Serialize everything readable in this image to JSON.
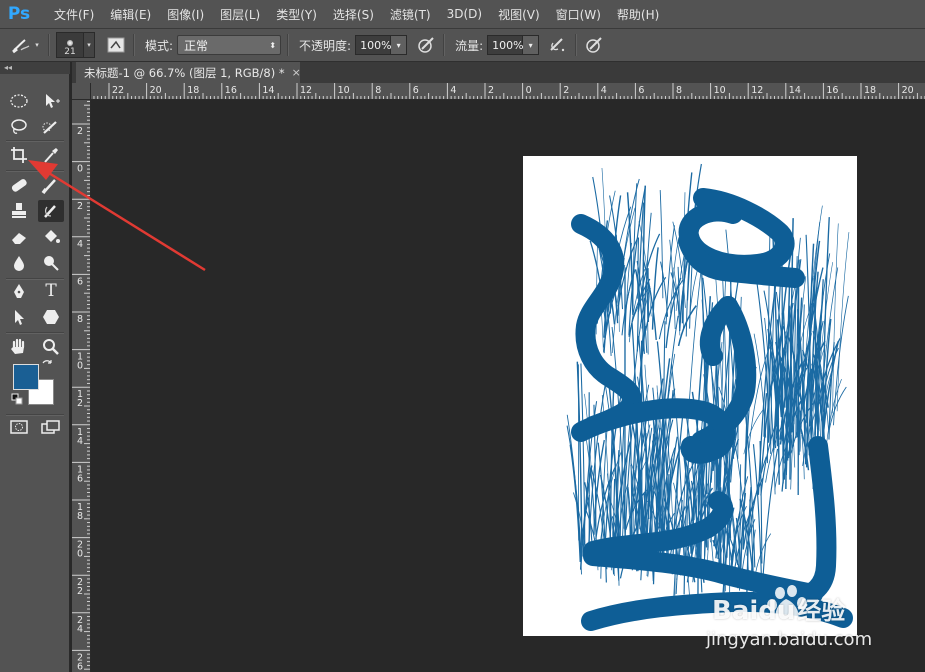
{
  "app": {
    "logo": "Ps"
  },
  "menu": [
    "文件(F)",
    "编辑(E)",
    "图像(I)",
    "图层(L)",
    "类型(Y)",
    "选择(S)",
    "滤镜(T)",
    "3D(D)",
    "视图(V)",
    "窗口(W)",
    "帮助(H)"
  ],
  "options": {
    "tool_icon": "brush-icon",
    "brush_size": "21",
    "mode_label": "模式:",
    "mode_value": "正常",
    "opacity_label": "不透明度:",
    "opacity_value": "100%",
    "flow_label": "流量:",
    "flow_value": "100%"
  },
  "toolbox": {
    "collapse": "◂◂",
    "tools": [
      "marquee-icon",
      "move-icon",
      "lasso-icon",
      "quick-select-icon",
      "crop-icon",
      "eyedropper-icon",
      "healing-icon",
      "brush-icon",
      "stamp-icon",
      "history-brush-icon",
      "eraser-icon",
      "paint-bucket-icon",
      "blur-icon",
      "dodge-icon",
      "pen-icon",
      "type-icon",
      "path-select-icon",
      "shape-icon",
      "hand-icon",
      "zoom-icon"
    ],
    "foreground_color": "#1a5f94",
    "background_color": "#ffffff"
  },
  "document": {
    "tab_title": "未标题-1 @ 66.7% (图层 1, RGB/8) *",
    "close_glyph": "×",
    "stroke_color": "#0e5e96"
  },
  "rulers": {
    "horizontal": [
      "22",
      "20",
      "18",
      "16",
      "14",
      "12",
      "10",
      "8",
      "6",
      "4",
      "2",
      "0",
      "2",
      "4",
      "6",
      "8",
      "10",
      "12",
      "14",
      "16",
      "18",
      "20"
    ],
    "vertical": [
      "2",
      "0",
      "2",
      "4",
      "6",
      "8",
      "1\n0",
      "1\n2",
      "1\n4",
      "1\n6",
      "1\n8",
      "2\n0",
      "2\n2",
      "2\n4",
      "2\n6"
    ]
  },
  "watermark": {
    "brand": "Baidu",
    "brand_cn": "经验",
    "url": "jingyan.baidu.com"
  }
}
